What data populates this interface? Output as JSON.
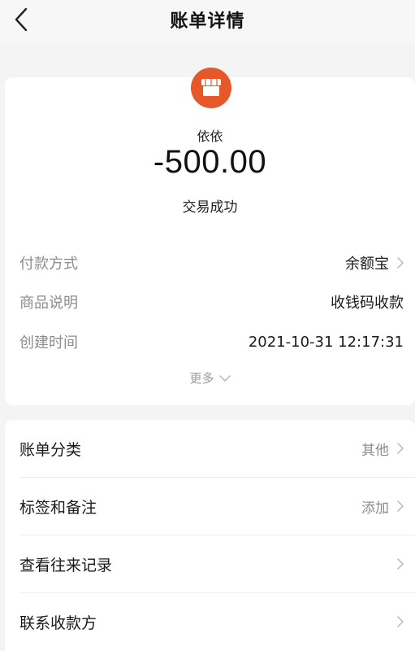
{
  "header": {
    "title": "账单详情",
    "back_icon": "chevron-left-icon"
  },
  "transaction": {
    "merchant_icon": "store-icon",
    "merchant_icon_color": "#E6572A",
    "merchant_name": "依依",
    "amount": "-500.00",
    "status": "交易成功"
  },
  "details": [
    {
      "label": "付款方式",
      "value": "余额宝",
      "has_chevron": true
    },
    {
      "label": "商品说明",
      "value": "收钱码收款",
      "has_chevron": false
    },
    {
      "label": "创建时间",
      "value": "2021-10-31 12:17:31",
      "has_chevron": false
    }
  ],
  "more_label": "更多",
  "actions": [
    {
      "label": "账单分类",
      "value": "其他"
    },
    {
      "label": "标签和备注",
      "value": "添加"
    },
    {
      "label": "查看往来记录",
      "value": ""
    },
    {
      "label": "联系收款方",
      "value": ""
    }
  ]
}
